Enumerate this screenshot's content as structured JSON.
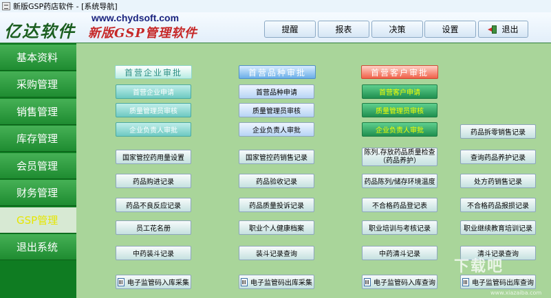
{
  "window": {
    "title": "新版GSP药店软件 - [系统导航]"
  },
  "header": {
    "logo_text": "亿达软件",
    "url": "www.chydsoft.com",
    "product_name": "新版GSP管理软件",
    "toolbar": [
      "提醒",
      "报表",
      "决策",
      "设置",
      "退出"
    ]
  },
  "sidebar": {
    "items": [
      "基本资料",
      "采购管理",
      "销售管理",
      "库存管理",
      "会员管理",
      "财务管理",
      "GSP管理",
      "退出系统"
    ],
    "active": "GSP管理"
  },
  "main": {
    "sections": [
      "首营企业审批",
      "首营品种审批",
      "首营客户审批"
    ],
    "col1": [
      "首营企业申请",
      "质量管理员审核",
      "企业负责人审批",
      "国家管控药用量设置",
      "药品购进记录",
      "药品不良反应记录",
      "员工花名册",
      "中药装斗记录",
      "电子监管码入库采集"
    ],
    "col2": [
      "首营品种申请",
      "质量管理员审核",
      "企业负责人审批",
      "国家管控药销售记录",
      "药品验收记录",
      "药品质量投诉记录",
      "职业个人健康档案",
      "装斗记录查询",
      "电子监管码出库采集"
    ],
    "col3": [
      "首营客户申请",
      "质量管理员审核",
      "企业负责人审批",
      "陈列.存放药品质量检查",
      "（药品养护）",
      "药品陈列/储存环境温度",
      "不合格药品登记表",
      "职业培训与考核记录",
      "中药清斗记录",
      "电子监管码入库查询"
    ],
    "col4": [
      "药品拆零销售记录",
      "查询药品养护记录",
      "处方药销售记录",
      "不合格药品报损记录",
      "职业继续教育培训记录",
      "清斗记录查询",
      "电子监管码出库查询"
    ]
  },
  "watermark": {
    "text": "下载吧",
    "url": "www.xiazaiba.com"
  }
}
